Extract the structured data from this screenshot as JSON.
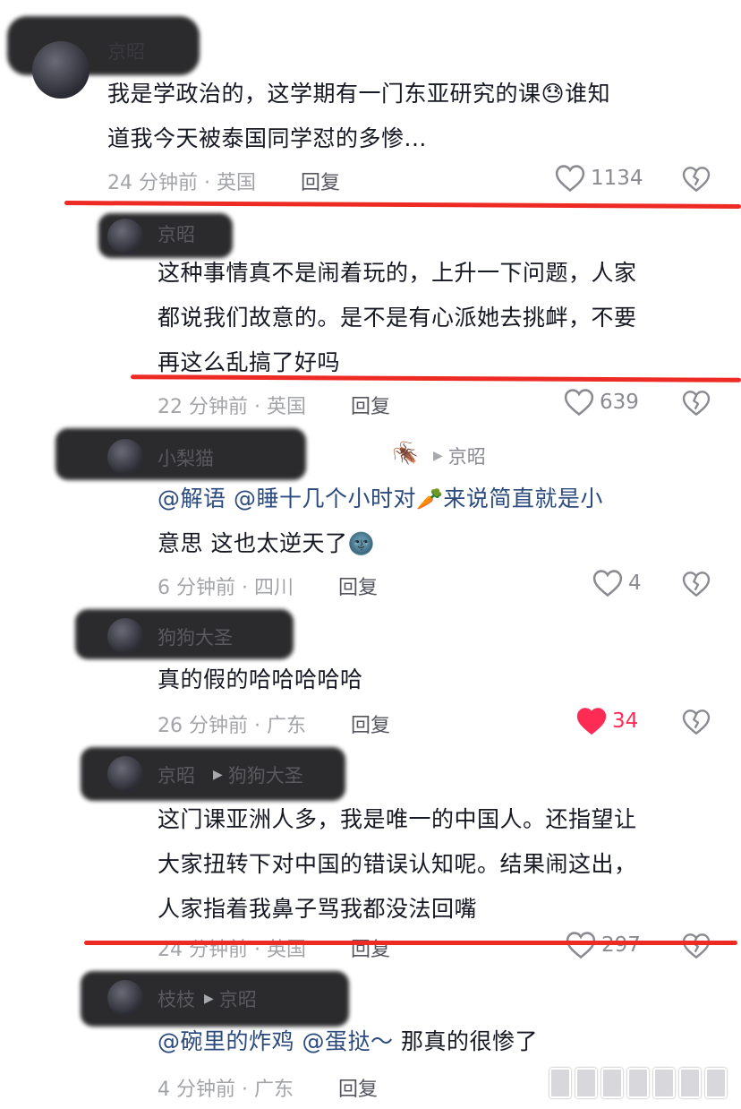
{
  "comments": [
    {
      "username": "京昭",
      "text_lines": [
        "我是学政治的，这学期有一门东亚研究的课😓谁知",
        "道我今天被泰国同学怼的多惨..."
      ],
      "meta": "24 分钟前 · 英国",
      "reply_label": "回复",
      "likes": "1134"
    },
    {
      "username": "京昭",
      "text_lines": [
        "这种事情真不是闹着玩的，上升一下问题，人家",
        "都说我们故意的。是不是有心派她去挑衅，不要",
        "再这么乱搞了好吗"
      ],
      "meta": "22 分钟前 · 英国",
      "reply_label": "回复",
      "likes": "639"
    },
    {
      "username": "小梨猫",
      "reply_to": "京昭",
      "mention1": "@解语",
      "mention2": "@睡十几个小时对",
      "carrot": "🥕",
      "line1_tail": "来说简直就是小",
      "line2": "意思 这也太逆天了",
      "moon": "🌚",
      "meta": "6 分钟前 · 四川",
      "reply_label": "回复",
      "likes": "4"
    },
    {
      "username": "狗狗大圣",
      "text_lines": [
        "真的假的哈哈哈哈哈"
      ],
      "meta": "26 分钟前 · 广东",
      "reply_label": "回复",
      "likes": "34"
    },
    {
      "username": "京昭",
      "reply_to": "狗狗大圣",
      "text_lines": [
        "这门课亚洲人多，我是唯一的中国人。还指望让",
        "大家扭转下对中国的错误认知呢。结果闹这出，",
        "人家指着我鼻子骂我都没法回嘴"
      ],
      "meta": "24 分钟前 · 英国",
      "reply_label": "回复",
      "likes": "297"
    },
    {
      "username": "枝枝",
      "reply_to": "京昭",
      "mention1": "@碗里的炸鸡",
      "mention2": "@蛋挞～",
      "tail": "那真的很惨了",
      "meta": "4 分钟前 · 广东",
      "reply_label": "回复"
    }
  ],
  "colors": {
    "liked_heart": "#fe2c55",
    "mention": "#2b4a7e",
    "annotation_line": "#ee2a24"
  },
  "icons": [
    "heart-icon",
    "broken-heart-icon",
    "cockroach-icon",
    "play-triangle-icon"
  ]
}
